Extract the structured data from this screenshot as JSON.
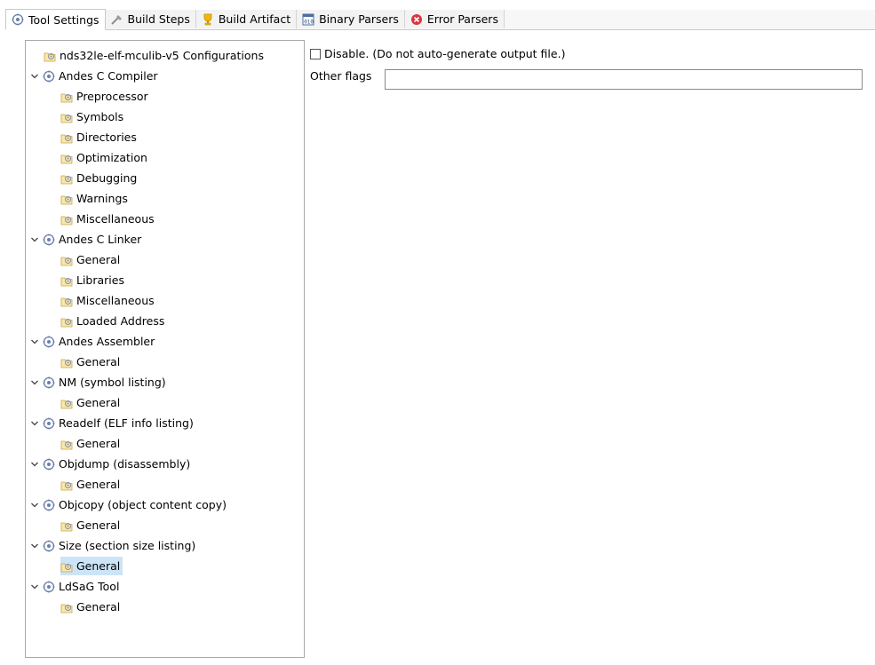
{
  "tabs": [
    {
      "label": "Tool Settings",
      "icon": "tool-settings-icon",
      "active": true
    },
    {
      "label": "Build Steps",
      "icon": "build-steps-icon",
      "active": false
    },
    {
      "label": "Build Artifact",
      "icon": "build-artifact-icon",
      "active": false
    },
    {
      "label": "Binary Parsers",
      "icon": "binary-parsers-icon",
      "active": false
    },
    {
      "label": "Error Parsers",
      "icon": "error-parsers-icon",
      "active": false
    }
  ],
  "tree": {
    "items": [
      {
        "label": "nds32le-elf-mculib-v5 Configurations",
        "level": 0,
        "type": "leaf"
      },
      {
        "label": "Andes C Compiler",
        "level": 0,
        "type": "tool",
        "expanded": true
      },
      {
        "label": "Preprocessor",
        "level": 1,
        "type": "leaf"
      },
      {
        "label": "Symbols",
        "level": 1,
        "type": "leaf"
      },
      {
        "label": "Directories",
        "level": 1,
        "type": "leaf"
      },
      {
        "label": "Optimization",
        "level": 1,
        "type": "leaf"
      },
      {
        "label": "Debugging",
        "level": 1,
        "type": "leaf"
      },
      {
        "label": "Warnings",
        "level": 1,
        "type": "leaf"
      },
      {
        "label": "Miscellaneous",
        "level": 1,
        "type": "leaf"
      },
      {
        "label": "Andes C Linker",
        "level": 0,
        "type": "tool",
        "expanded": true
      },
      {
        "label": "General",
        "level": 1,
        "type": "leaf"
      },
      {
        "label": "Libraries",
        "level": 1,
        "type": "leaf"
      },
      {
        "label": "Miscellaneous",
        "level": 1,
        "type": "leaf"
      },
      {
        "label": "Loaded Address",
        "level": 1,
        "type": "leaf"
      },
      {
        "label": "Andes Assembler",
        "level": 0,
        "type": "tool",
        "expanded": true
      },
      {
        "label": "General",
        "level": 1,
        "type": "leaf"
      },
      {
        "label": "NM (symbol listing)",
        "level": 0,
        "type": "tool",
        "expanded": true
      },
      {
        "label": "General",
        "level": 1,
        "type": "leaf"
      },
      {
        "label": "Readelf (ELF info listing)",
        "level": 0,
        "type": "tool",
        "expanded": true
      },
      {
        "label": "General",
        "level": 1,
        "type": "leaf"
      },
      {
        "label": "Objdump (disassembly)",
        "level": 0,
        "type": "tool",
        "expanded": true
      },
      {
        "label": "General",
        "level": 1,
        "type": "leaf"
      },
      {
        "label": "Objcopy (object content copy)",
        "level": 0,
        "type": "tool",
        "expanded": true
      },
      {
        "label": "General",
        "level": 1,
        "type": "leaf"
      },
      {
        "label": "Size (section size listing)",
        "level": 0,
        "type": "tool",
        "expanded": true
      },
      {
        "label": "General",
        "level": 1,
        "type": "leaf",
        "selected": true
      },
      {
        "label": "LdSaG Tool",
        "level": 0,
        "type": "tool",
        "expanded": true
      },
      {
        "label": "General",
        "level": 1,
        "type": "leaf"
      }
    ]
  },
  "options": {
    "disable_label": "Disable. (Do not auto-generate output file.)",
    "disable_checked": false,
    "other_flags_label": "Other flags",
    "other_flags_value": ""
  },
  "colors": {
    "selection": "#cce4f7",
    "error_red": "#d9363e",
    "trophy_gold": "#f2b705"
  }
}
